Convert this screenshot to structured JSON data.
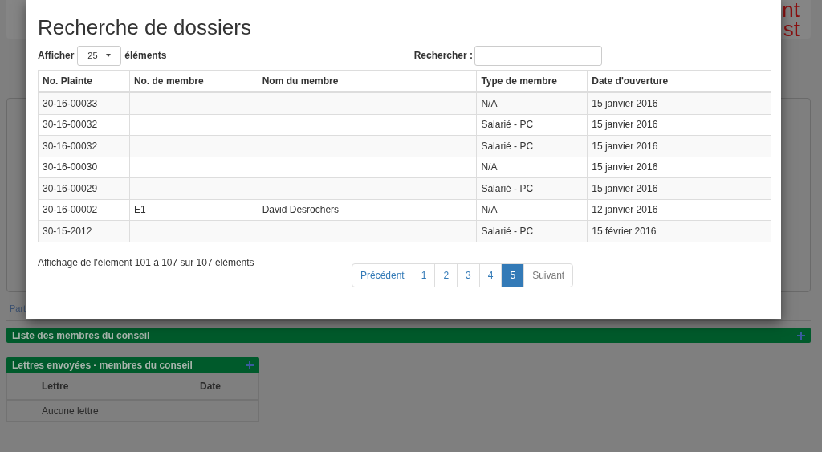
{
  "background": {
    "header_fragments": [
      "nt",
      "st"
    ],
    "side_link": "Part",
    "council_bar": {
      "title": "Liste des membres du conseil"
    },
    "letters_panel": {
      "title": "Lettres envoyées - membres du conseil",
      "columns": [
        "Lettre",
        "Date"
      ],
      "empty_text": "Aucune lettre"
    }
  },
  "modal": {
    "title": "Recherche de dossiers",
    "length_label_before": "Afficher",
    "length_value": "25",
    "length_label_after": "éléments",
    "search_label": "Rechercher :",
    "table": {
      "columns": [
        "No. Plainte",
        "No. de membre",
        "Nom du membre",
        "Type de membre",
        "Date d'ouverture"
      ],
      "rows": [
        {
          "plainte": "30-16-00033",
          "type": "N/A",
          "date": "15 janvier 2016"
        },
        {
          "plainte": "30-16-00032",
          "type": "Salarié - PC",
          "date": "15 janvier 2016"
        },
        {
          "plainte": "30-16-00032",
          "type": "Salarié - PC",
          "date": "15 janvier 2016"
        },
        {
          "plainte": "30-16-00030",
          "type": "N/A",
          "date": "15 janvier 2016"
        },
        {
          "plainte": "30-16-00029",
          "type": "Salarié - PC",
          "date": "15 janvier 2016"
        },
        {
          "plainte": "30-16-00002",
          "member_no": "E1",
          "member_name": "David Desrochers",
          "type": "N/A",
          "date": "12 janvier 2016"
        },
        {
          "plainte": "30-15-2012",
          "type": "Salarié - PC",
          "date": "15 février 2016"
        }
      ]
    },
    "info": "Affichage de l'élement 101 à 107 sur 107 éléments",
    "pagination": [
      {
        "label": "Précédent",
        "selected": false,
        "disabled": false
      },
      {
        "label": "1",
        "selected": false,
        "disabled": false
      },
      {
        "label": "2",
        "selected": false,
        "disabled": false
      },
      {
        "label": "3",
        "selected": false,
        "disabled": false
      },
      {
        "label": "4",
        "selected": false,
        "disabled": false
      },
      {
        "label": "5",
        "selected": true,
        "disabled": false
      },
      {
        "label": "Suivant",
        "selected": false,
        "disabled": true
      }
    ]
  }
}
